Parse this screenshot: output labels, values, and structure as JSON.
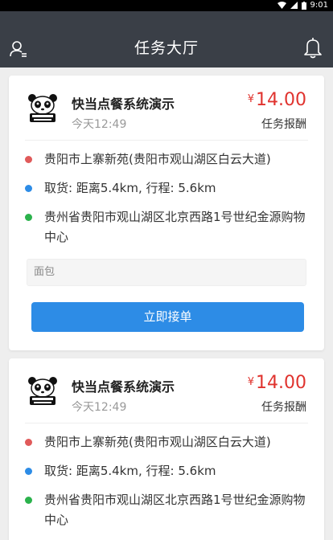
{
  "status_bar": {
    "time": "9:01"
  },
  "header": {
    "title": "任务大厅"
  },
  "orders": [
    {
      "shop_name": "快当点餐系统演示",
      "time": "今天12:49",
      "currency": "¥",
      "price": "14.00",
      "price_label": "任务报酬",
      "pickup_address": "贵阳市上寨新苑(贵阳市观山湖区白云大道)",
      "distance_text": "取货:  距离5.4km,  行程:  5.6km",
      "delivery_address": "贵州省贵阳市观山湖区北京西路1号世纪金源购物中心",
      "note": "面包",
      "accept_label": "立即接单"
    },
    {
      "shop_name": "快当点餐系统演示",
      "time": "今天12:49",
      "currency": "¥",
      "price": "14.00",
      "price_label": "任务报酬",
      "pickup_address": "贵阳市上寨新苑(贵阳市观山湖区白云大道)",
      "distance_text": "取货:  距离5.4km,  行程:  5.6km",
      "delivery_address": "贵州省贵阳市观山湖区北京西路1号世纪金源购物中心"
    }
  ],
  "colors": {
    "header_bg": "#3a3f47",
    "price": "#e0332e",
    "pickup_dot": "#e05a5a",
    "distance_dot": "#2d8ce6",
    "delivery_dot": "#2bb24c",
    "accept_button": "#2d8ce6"
  }
}
